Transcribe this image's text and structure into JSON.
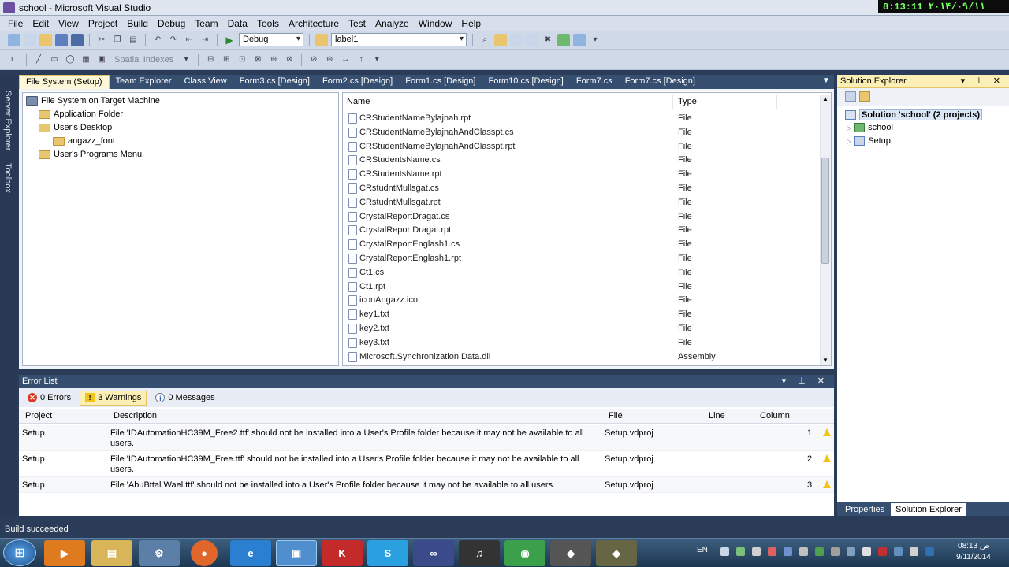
{
  "window": {
    "title": "school - Microsoft Visual Studio",
    "clock": "8:13:11  ۲۰۱۴/۰۹/۱۱"
  },
  "menu": [
    "File",
    "Edit",
    "View",
    "Project",
    "Build",
    "Debug",
    "Team",
    "Data",
    "Tools",
    "Architecture",
    "Test",
    "Analyze",
    "Window",
    "Help"
  ],
  "toolbar": {
    "config": "Debug",
    "target": "label1",
    "spatial": "Spatial Indexes"
  },
  "left_strip": {
    "server_explorer": "Server Explorer",
    "toolbox": "Toolbox"
  },
  "doc_tabs": [
    "File System (Setup)",
    "Team Explorer",
    "Class View",
    "Form3.cs [Design]",
    "Form2.cs [Design]",
    "Form1.cs [Design]",
    "Form10.cs [Design]",
    "Form7.cs",
    "Form7.cs [Design]"
  ],
  "fs_tree": {
    "root": "File System on Target Machine",
    "items": [
      "Application Folder",
      "User's Desktop",
      "angazz_font",
      "User's Programs Menu"
    ]
  },
  "files": {
    "col_name": "Name",
    "col_type": "Type",
    "rows": [
      {
        "name": "CRStudentNameBylajnah.rpt",
        "type": "File"
      },
      {
        "name": "CRStudentNameBylajnahAndClasspt.cs",
        "type": "File"
      },
      {
        "name": "CRStudentNameBylajnahAndClasspt.rpt",
        "type": "File"
      },
      {
        "name": "CRStudentsName.cs",
        "type": "File"
      },
      {
        "name": "CRStudentsName.rpt",
        "type": "File"
      },
      {
        "name": "CRstudntMullsgat.cs",
        "type": "File"
      },
      {
        "name": "CRstudntMullsgat.rpt",
        "type": "File"
      },
      {
        "name": "CrystalReportDragat.cs",
        "type": "File"
      },
      {
        "name": "CrystalReportDragat.rpt",
        "type": "File"
      },
      {
        "name": "CrystalReportEnglash1.cs",
        "type": "File"
      },
      {
        "name": "CrystalReportEnglash1.rpt",
        "type": "File"
      },
      {
        "name": "Ct1.cs",
        "type": "File"
      },
      {
        "name": "Ct1.rpt",
        "type": "File"
      },
      {
        "name": "iconAngazz.ico",
        "type": "File"
      },
      {
        "name": "key1.txt",
        "type": "File"
      },
      {
        "name": "key2.txt",
        "type": "File"
      },
      {
        "name": "key3.txt",
        "type": "File"
      },
      {
        "name": "Microsoft.Synchronization.Data.dll",
        "type": "Assembly"
      }
    ]
  },
  "error_list": {
    "title": "Error List",
    "tab_errors": "0 Errors",
    "tab_warnings": "3 Warnings",
    "tab_messages": "0 Messages",
    "headers": {
      "project": "Project",
      "description": "Description",
      "file": "File",
      "line": "Line",
      "column": "Column"
    },
    "rows": [
      {
        "project": "Setup",
        "description": "File 'IDAutomationHC39M_Free2.ttf' should not be installed into a User's Profile folder because it may not be available to all users.",
        "file": "Setup.vdproj",
        "line": "",
        "column": "1"
      },
      {
        "project": "Setup",
        "description": "File 'IDAutomationHC39M_Free.ttf' should not be installed into a User's Profile folder because it may not be available to all users.",
        "file": "Setup.vdproj",
        "line": "",
        "column": "2"
      },
      {
        "project": "Setup",
        "description": "File 'AbuBttal Wael.ttf' should not be installed into a User's Profile folder because it may not be available to all users.",
        "file": "Setup.vdproj",
        "line": "",
        "column": "3"
      }
    ]
  },
  "solution_explorer": {
    "title": "Solution Explorer",
    "solution": "Solution 'school' (2 projects)",
    "projects": [
      "school",
      "Setup"
    ],
    "bottom_tabs": [
      "Properties",
      "Solution Explorer"
    ]
  },
  "status": {
    "text": "Build succeeded"
  },
  "tray": {
    "lang": "EN",
    "time": "08:13 ص",
    "date": "9/11/2014"
  }
}
